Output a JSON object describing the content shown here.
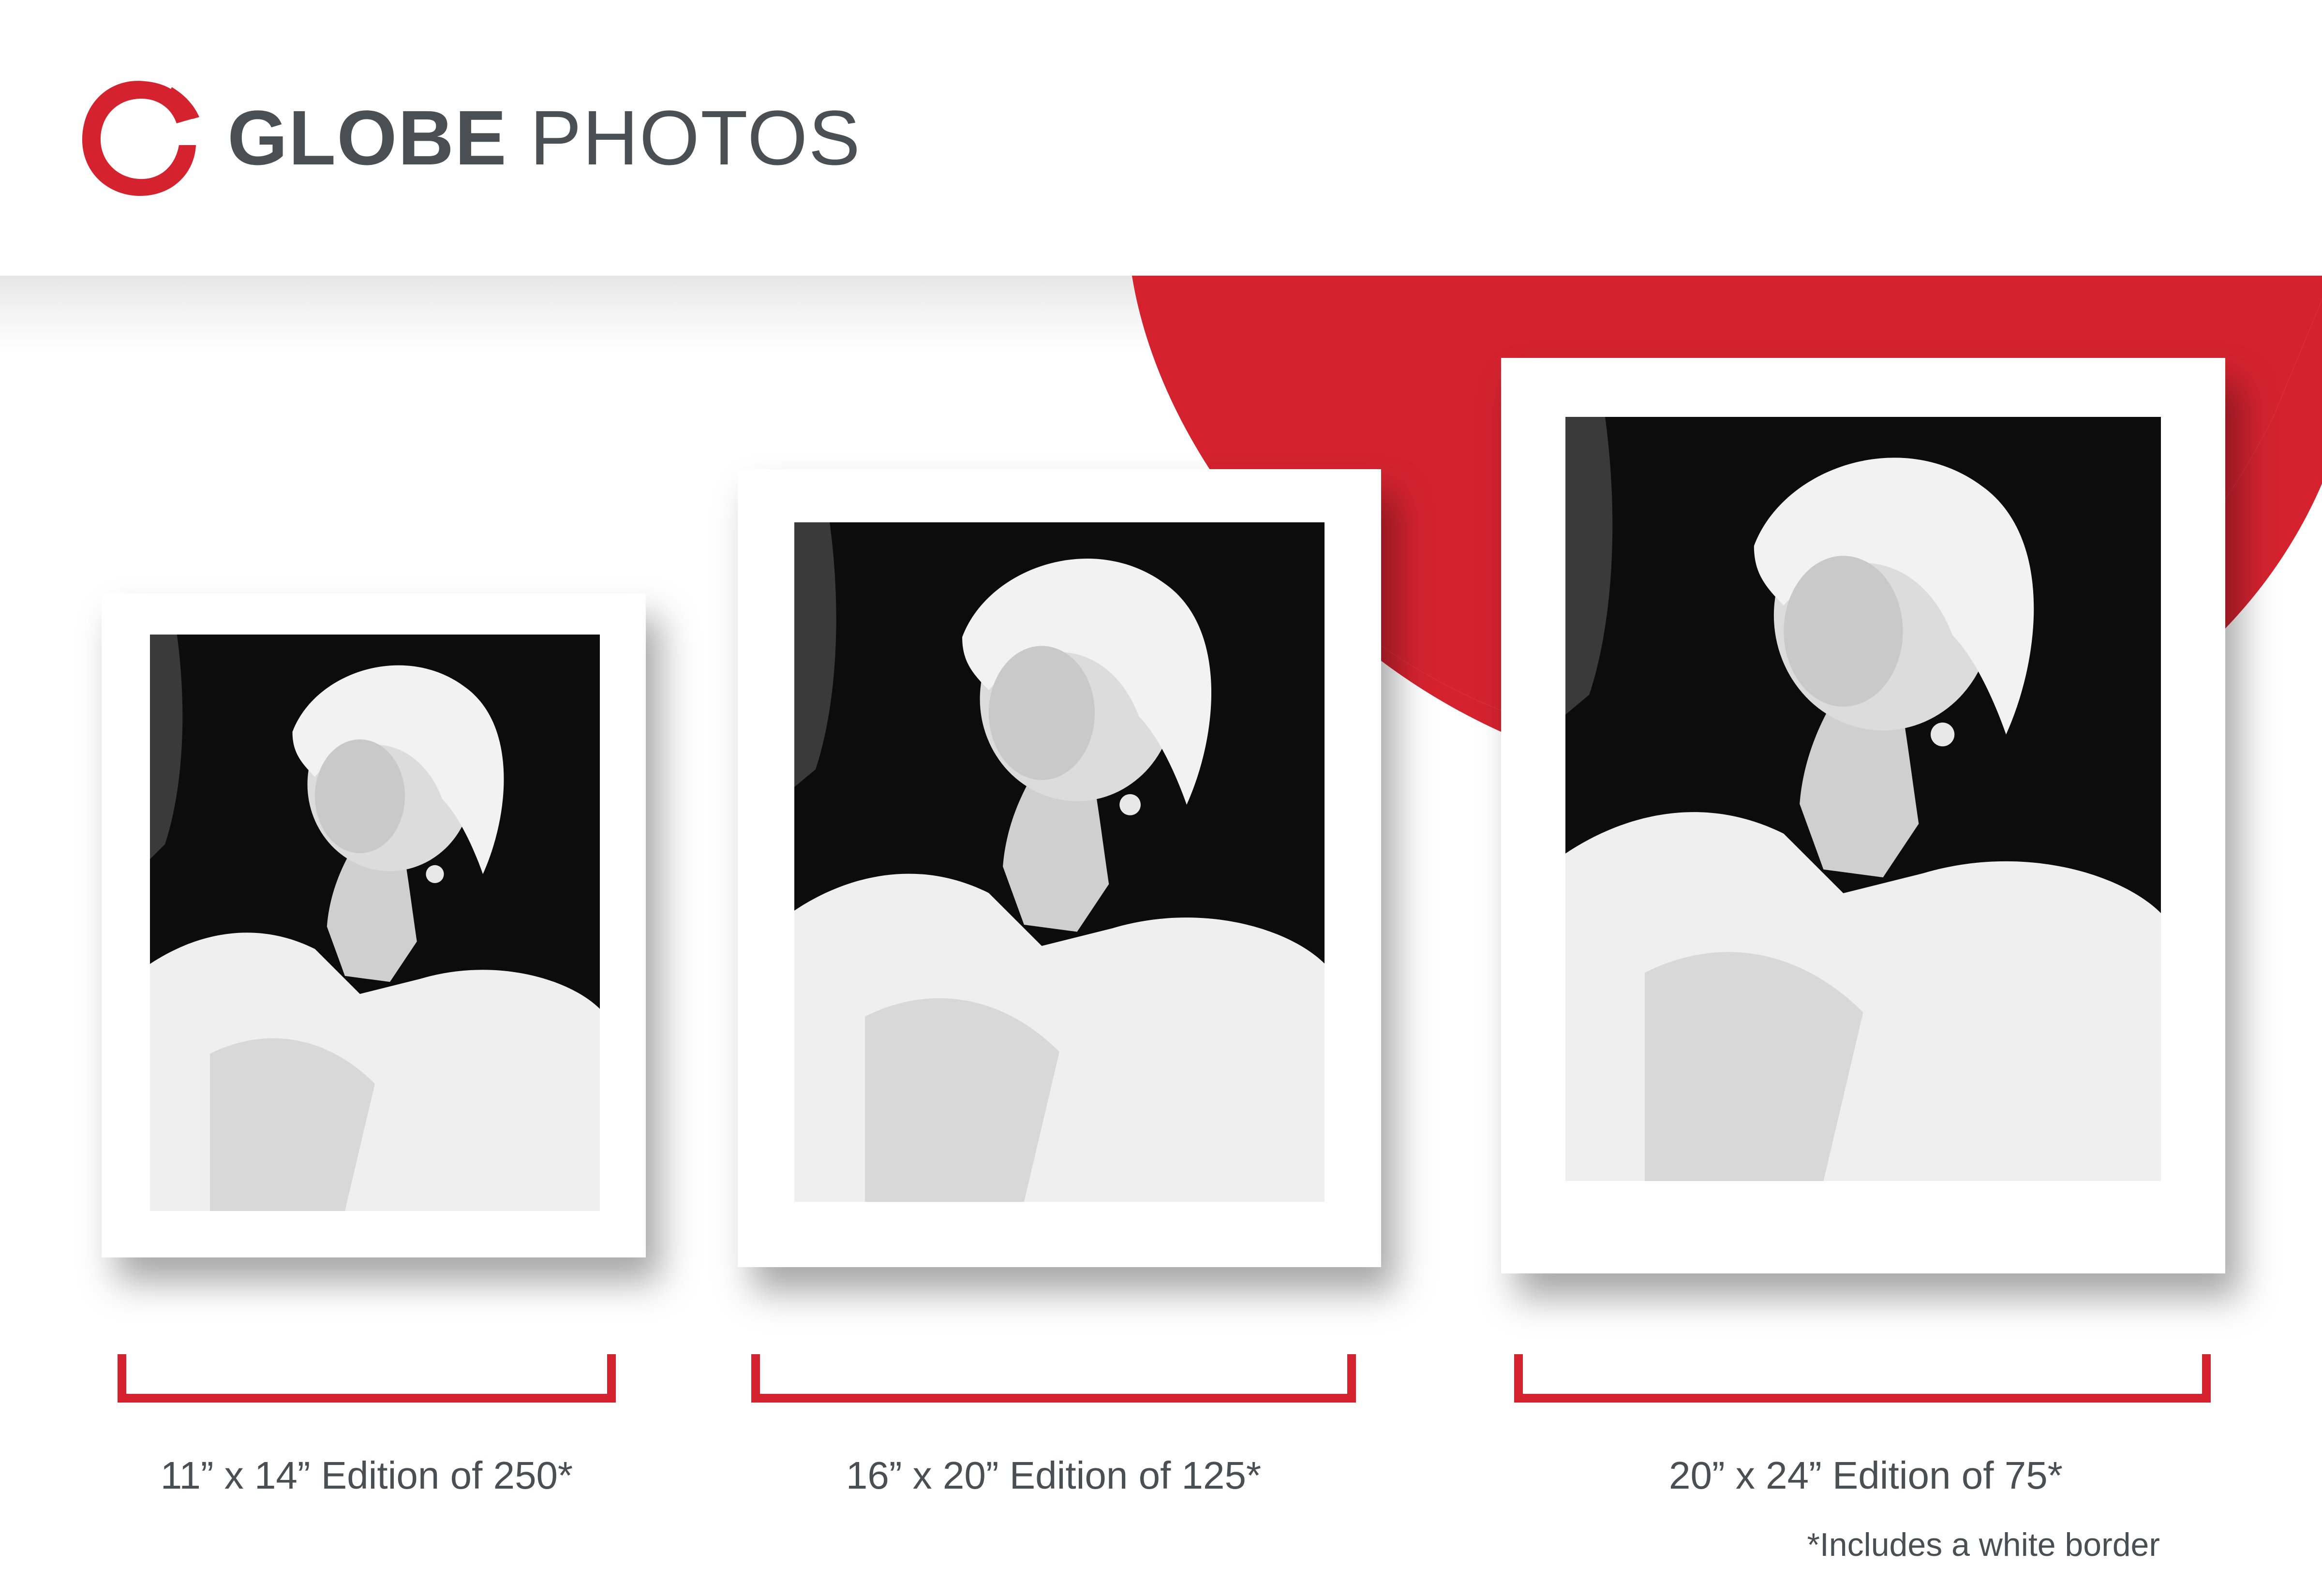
{
  "brand": {
    "name_bold": "GLOBE",
    "name_light": "PHOTOS",
    "logo_icon": "brush-circle-logo-icon",
    "accent_color": "#d4232f",
    "text_color": "#4a4f53"
  },
  "prints": [
    {
      "caption": "11” x 14” Edition of 250*"
    },
    {
      "caption": "16” x 20” Edition of 125*"
    },
    {
      "caption": "20” x 24” Edition of 75*"
    }
  ],
  "footnote": "*Includes a white border"
}
